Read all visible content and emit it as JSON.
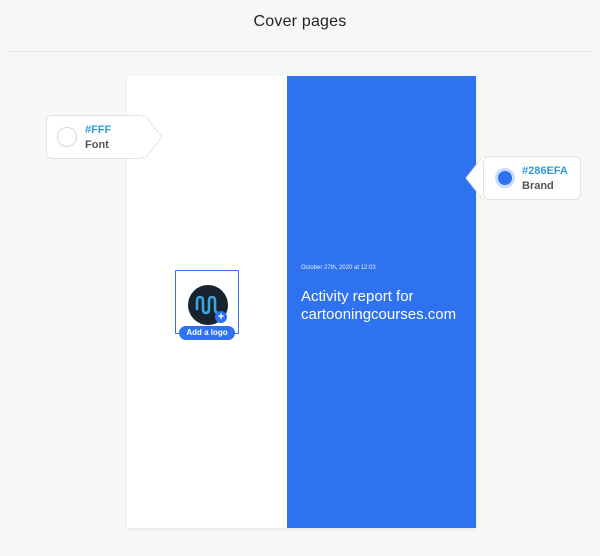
{
  "header": {
    "title": "Cover pages"
  },
  "font_swatch": {
    "hex": "#FFF",
    "label": "Font",
    "color": "#FFFFFF"
  },
  "brand_swatch": {
    "hex": "#286EFA",
    "label": "Brand",
    "color": "#286EFA"
  },
  "cover": {
    "date": "October 27th, 2020 at 12:03",
    "title": "Activity report for cartooningcourses.com",
    "logo": {
      "icon": "wave-logo-icon",
      "add_label": "Add a logo",
      "add_icon": "plus-icon"
    }
  }
}
